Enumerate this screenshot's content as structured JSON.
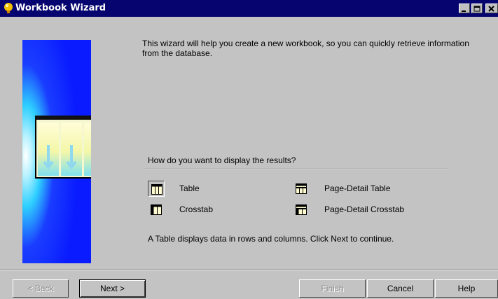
{
  "window": {
    "title": "Workbook Wizard"
  },
  "intro": {
    "text": "This wizard will help you create a new workbook, so you can quickly retrieve information from the database."
  },
  "question": "How do you want to display the results?",
  "options": [
    {
      "label": "Table",
      "icon": "table-icon",
      "selected": true
    },
    {
      "label": "Crosstab",
      "icon": "crosstab-icon",
      "selected": false
    },
    {
      "label": "Page-Detail Table",
      "icon": "page-detail-table-icon",
      "selected": false
    },
    {
      "label": "Page-Detail Crosstab",
      "icon": "page-detail-crosstab-icon",
      "selected": false
    }
  ],
  "description": "A Table displays data in rows and columns. Click Next to continue.",
  "buttons": {
    "back": "< Back",
    "next": "Next >",
    "finish": "Finish",
    "cancel": "Cancel",
    "help": "Help"
  },
  "colors": {
    "titlebar": "#06046f",
    "art_blue": "#0a1cff",
    "face": "#c3c3c3"
  }
}
